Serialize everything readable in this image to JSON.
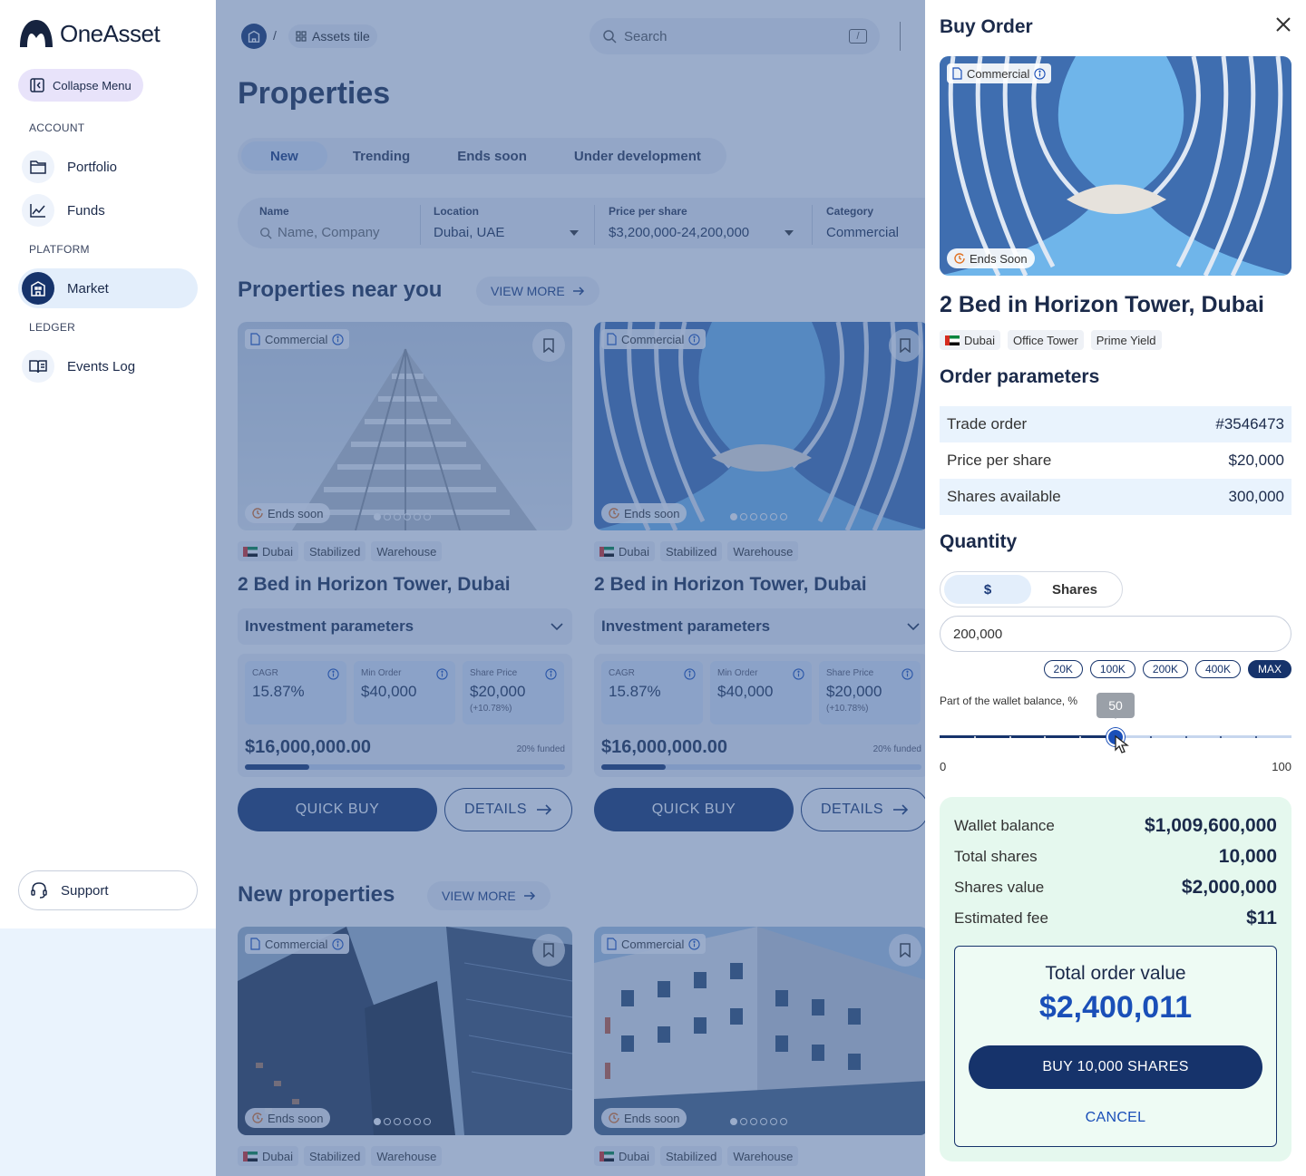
{
  "app": {
    "name": "OneAsset"
  },
  "sidebar": {
    "collapse_label": "Collapse Menu",
    "sections": {
      "account": "ACCOUNT",
      "platform": "PLATFORM",
      "ledger": "LEDGER"
    },
    "items": [
      {
        "label": "Portfolio",
        "icon": "folder-icon"
      },
      {
        "label": "Funds",
        "icon": "chart-line-icon"
      },
      {
        "label": "Market",
        "icon": "building-icon",
        "active": true
      },
      {
        "label": "Events Log",
        "icon": "book-icon"
      }
    ],
    "support_label": "Support"
  },
  "header": {
    "breadcrumb_sep": "/",
    "breadcrumb_current": "Assets tile",
    "search_placeholder": "Search",
    "search_shortcut": "/"
  },
  "main": {
    "title": "Properties",
    "tabs": [
      {
        "label": "New",
        "active": true
      },
      {
        "label": "Trending"
      },
      {
        "label": "Ends soon"
      },
      {
        "label": "Under development"
      }
    ],
    "filters": {
      "name": {
        "label": "Name",
        "placeholder": "Name, Company"
      },
      "location": {
        "label": "Location",
        "value": "Dubai, UAE"
      },
      "price": {
        "label": "Price per share",
        "value": "$3,200,000-24,200,000"
      },
      "category": {
        "label": "Category",
        "value": "Commercial"
      }
    },
    "near_title": "Properties near you",
    "new_title": "New properties",
    "view_more": "VIEW MORE",
    "cards": [
      {
        "category": "Commercial",
        "ends": "Ends soon",
        "tags": [
          "Dubai",
          "Stabilized",
          "Warehouse"
        ],
        "title": "2 Bed in Horizon Tower, Dubai",
        "inv_label": "Investment parameters",
        "cagr_label": "CAGR",
        "cagr": "15.87%",
        "min_label": "Min Order",
        "min": "$40,000",
        "share_label": "Share Price",
        "share": "$20,000",
        "share_change": "(+10.78%)",
        "total": "$16,000,000.00",
        "funded": "20% funded",
        "funded_pct": 20,
        "quick_buy": "QUICK BUY",
        "details": "DETAILS"
      },
      {
        "category": "Commercial",
        "ends": "Ends soon",
        "tags": [
          "Dubai",
          "Stabilized",
          "Warehouse"
        ],
        "title": "2 Bed in Horizon Tower, Dubai",
        "inv_label": "Investment parameters",
        "cagr_label": "CAGR",
        "cagr": "15.87%",
        "min_label": "Min Order",
        "min": "$40,000",
        "share_label": "Share Price",
        "share": "$20,000",
        "share_change": "(+10.78%)",
        "total": "$16,000,000.00",
        "funded": "20% funded",
        "funded_pct": 20,
        "quick_buy": "QUICK BUY",
        "details": "DETAILS"
      },
      {
        "category": "Commercial",
        "ends": "Ends soon",
        "tags": [
          "Dubai",
          "Stabilized",
          "Warehouse"
        ]
      },
      {
        "category": "Commercial",
        "ends": "Ends soon",
        "tags": [
          "Dubai",
          "Stabilized",
          "Warehouse"
        ]
      }
    ]
  },
  "panel": {
    "title": "Buy Order",
    "category": "Commercial",
    "ends": "Ends Soon",
    "name": "2 Bed in Horizon Tower, Dubai",
    "tags": [
      "Dubai",
      "Office Tower",
      "Prime Yield"
    ],
    "order_title": "Order parameters",
    "rows": [
      {
        "k": "Trade order",
        "v": "#3546473"
      },
      {
        "k": "Price per share",
        "v": "$20,000"
      },
      {
        "k": "Shares available",
        "v": "300,000"
      }
    ],
    "quantity_title": "Quantity",
    "toggle": [
      "$",
      "Shares"
    ],
    "amount": "200,000",
    "chips": [
      "20K",
      "100K",
      "200K",
      "400K",
      "MAX"
    ],
    "wallet_label": "Part of the wallet balance, %",
    "slider_value": "50",
    "slider_pct": 50,
    "slider_min": "0",
    "slider_max": "100",
    "summary": [
      {
        "k": "Wallet balance",
        "v": "$1,009,600,000"
      },
      {
        "k": "Total shares",
        "v": "10,000"
      },
      {
        "k": "Shares value",
        "v": "$2,000,000"
      },
      {
        "k": "Estimated fee",
        "v": "$11"
      }
    ],
    "total_label": "Total order value",
    "total_value": "$2,400,011",
    "buy_label": "BUY 10,000 SHARES",
    "cancel_label": "CANCEL"
  },
  "colors": {
    "primary": "#16336b",
    "accent": "#1a4fb8",
    "overlay": "#3f629b",
    "summary_bg": "#e5f8ee"
  }
}
